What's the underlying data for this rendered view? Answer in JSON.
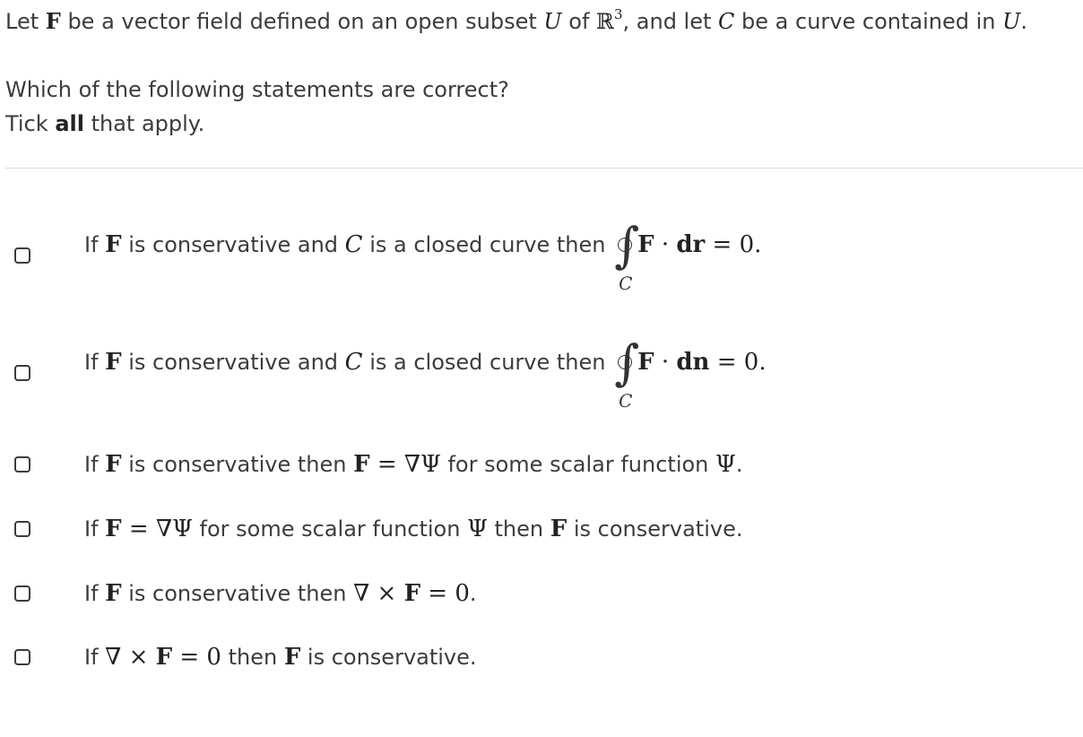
{
  "intro": {
    "t1": "Let ",
    "F": "F",
    "t2": " be a vector field defined on an open subset ",
    "U": "U",
    "t3": " of ",
    "R": "ℝ",
    "exp": "3",
    "t4": ", and let ",
    "C": "C",
    "t5": " be a curve contained in ",
    "U2": "U",
    "t6": "."
  },
  "question": {
    "line1": "Which of the following statements are correct?",
    "tick_pre": "Tick ",
    "tick_strong": "all",
    "tick_post": " that apply."
  },
  "options": [
    {
      "checked": false,
      "p1": "If ",
      "F": "F",
      "p2": " is conservative and ",
      "C": "C",
      "p3": " is a closed curve then ",
      "integral_sub": "C",
      "expr_F": "F",
      "dot": " · ",
      "expr_d": "dr",
      "expr_end": " = 0."
    },
    {
      "checked": false,
      "p1": "If ",
      "F": "F",
      "p2": " is conservative and ",
      "C": "C",
      "p3": " is a closed curve then ",
      "integral_sub": "C",
      "expr_F": "F",
      "dot": " · ",
      "expr_d": "dn",
      "expr_end": " = 0."
    },
    {
      "checked": false,
      "p1": "If ",
      "F": "F",
      "p2": " is conservative then ",
      "F2": "F",
      "eq": " = ∇Ψ",
      "p3": " for some scalar function ",
      "psi": "Ψ",
      "p4": "."
    },
    {
      "checked": false,
      "p1": "If ",
      "F": "F",
      "eq": " = ∇Ψ",
      "p2": " for some scalar function ",
      "psi": "Ψ",
      "p3": " then ",
      "F2": "F",
      "p4": " is conservative."
    },
    {
      "checked": false,
      "p1": "If ",
      "F": "F",
      "p2": " is conservative then ",
      "curl": "∇ × ",
      "F2": "F",
      "eq": " = 0",
      "p3": "."
    },
    {
      "checked": false,
      "p1": "If ",
      "curl": "∇ × ",
      "F": "F",
      "eq": " = 0",
      "p2": " then ",
      "F2": "F",
      "p3": " is conservative."
    }
  ]
}
